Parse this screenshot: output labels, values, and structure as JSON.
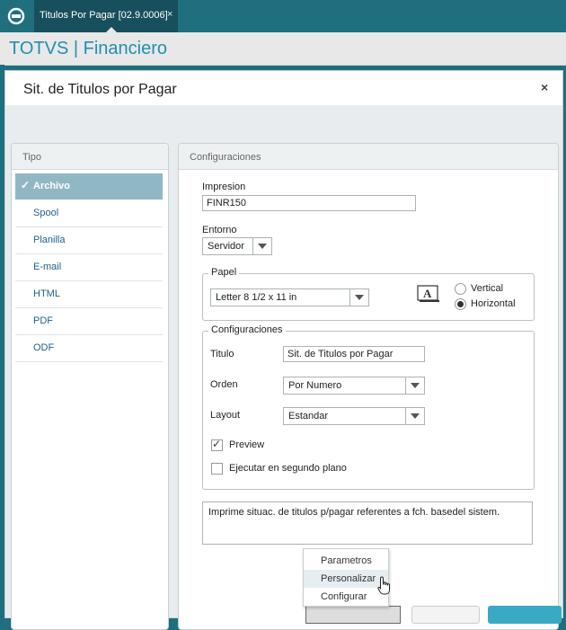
{
  "window": {
    "tab_label": "Titulos Por Pagar [02.9.0006]",
    "tab_close": "×",
    "app_title": "TOTVS | Financiero"
  },
  "dialog": {
    "title": "Sit. de Titulos por Pagar",
    "close": "×"
  },
  "tipo": {
    "header": "Tipo",
    "selected_check": "✓",
    "items": [
      {
        "label": "Archivo"
      },
      {
        "label": "Spool"
      },
      {
        "label": "Planilla"
      },
      {
        "label": "E-mail"
      },
      {
        "label": "HTML"
      },
      {
        "label": "PDF"
      },
      {
        "label": "ODF"
      }
    ]
  },
  "config": {
    "header": "Configuraciones",
    "impresion_label": "Impresion",
    "impresion_value": "FINR150",
    "entorno_label": "Entorno",
    "entorno_value": "Servidor",
    "papel": {
      "legend": "Papel",
      "paper_value": "Letter 8 1/2 x 11 in",
      "vertical_label": "Vertical",
      "horizontal_label": "Horizontal",
      "orientation_selected": "Horizontal"
    },
    "configuraciones": {
      "legend": "Configuraciones",
      "titulo_label": "Titulo",
      "titulo_value": "Sit. de Titulos por Pagar",
      "orden_label": "Orden",
      "orden_value": "Por Numero",
      "layout_label": "Layout",
      "layout_value": "Estandar",
      "preview_label": "Preview",
      "preview_checked": true,
      "segundo_plano_label": "Ejecutar en segundo plano",
      "segundo_plano_checked": false
    },
    "description": "Imprime situac. de titulos p/pagar referentes a fch. basedel sistem."
  },
  "menu": {
    "items": [
      {
        "label": "Parametros"
      },
      {
        "label": "Personalizar"
      },
      {
        "label": "Configurar"
      }
    ],
    "highlighted": "Personalizar"
  },
  "icons": {
    "logo": "totvs-logo-icon",
    "paper_orientation": "paper-orientation-icon",
    "cursor": "hand-pointer-icon"
  },
  "colors": {
    "brand_teal": "#1f6f7e",
    "title_blue": "#1f8fb0",
    "selected_tipo": "#8fb8c4",
    "primary_button": "#3aa9c4"
  }
}
